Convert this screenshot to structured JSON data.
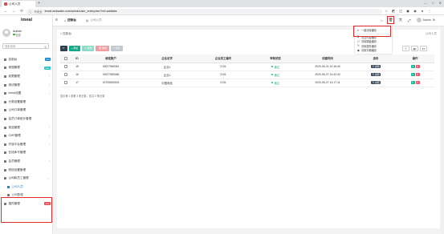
{
  "browser": {
    "tab_title": "公司人员",
    "address_secure_label": "不安全",
    "url": "imeal.webwaltz.com/admin/user_enterprise?ref=addtabs",
    "window_controls": [
      "—",
      "□",
      "✕"
    ]
  },
  "sidebar": {
    "brand": "imeal",
    "user_name": "Admin",
    "user_status": "在线",
    "search_placeholder": "搜索菜单",
    "items": [
      {
        "label": "控制台",
        "badge": "hot",
        "badge_color": "#1c84c6"
      },
      {
        "label": "常规管理",
        "badge": "new",
        "badge_color": "#23c6c8"
      },
      {
        "label": "权限管理"
      },
      {
        "label": "测试管理"
      },
      {
        "label": "imeal设置"
      },
      {
        "label": "分类设置管理"
      },
      {
        "label": "公司订单管理"
      },
      {
        "label": "会员订单统计管理"
      },
      {
        "label": "菜品管理"
      },
      {
        "label": "CMS管理"
      },
      {
        "label": "开放平台管理"
      },
      {
        "label": "在线命令管理"
      },
      {
        "label": "会员管理"
      },
      {
        "label": "短信设置管理"
      },
      {
        "label": "公司和员工管理"
      },
      {
        "label": "公司人员"
      },
      {
        "label": "公司数据"
      },
      {
        "label": "插件管理",
        "badge": "new",
        "badge_color": "#e8484c"
      }
    ]
  },
  "header": {
    "tabs": [
      {
        "label": "控制台"
      },
      {
        "label": "公司人员"
      }
    ],
    "admin_name": "Admin"
  },
  "dropdown": {
    "items": [
      {
        "icon": "≡",
        "label": "一键清除缓存"
      },
      {
        "icon": "B",
        "label": "清空内容缓存"
      },
      {
        "icon": "☐",
        "label": "清除模板缓存"
      },
      {
        "icon": "✎",
        "label": "清除插件缓存"
      },
      {
        "icon": "◆",
        "label": "清除字典缓存"
      }
    ]
  },
  "content": {
    "breadcrumb": "控制台",
    "breadcrumb_right": "公司人员",
    "toolbar": [
      {
        "label": "↻",
        "color": "#2f4050"
      },
      {
        "label": "+ 添加",
        "color": "#18a689"
      },
      {
        "label": "✎ 编辑",
        "color": "#8fdac6"
      },
      {
        "label": "🗑 删除",
        "color": "#f09ea0"
      },
      {
        "label": "≡ 更多",
        "color": "#c1c7cc"
      }
    ],
    "right_tools": [
      "☰",
      "▦▾",
      "⬇▾"
    ],
    "table": {
      "headers": [
        "",
        "ID",
        "绑定账户",
        "企业名字",
        "企业员工编号",
        "审核状态",
        "创建时间",
        "身份",
        "操作"
      ],
      "rows": [
        {
          "id": "15",
          "account": "15027580061",
          "company": "企业1",
          "code": "2131",
          "status": "通过",
          "time": "2020-06-21 10:16:40",
          "role": "詳细"
        },
        {
          "id": "16",
          "account": "15027580066",
          "company": "企业1",
          "code": "2131",
          "status": "通过",
          "time": "2020-06-27 14:42:42",
          "role": "詳细"
        },
        {
          "id": "17",
          "account": "15705550003",
          "company": "中国电信",
          "code": "2131",
          "status": "通过",
          "time": "2020-06-27 14:17:11",
          "role": "詳细"
        }
      ]
    },
    "pager": "显示第 1 到第 3 条记录，总共 3 条记录"
  },
  "colors": {
    "accent": "#1c84c6",
    "highlight": "#e02b2b",
    "status_green": "#1ab394"
  }
}
